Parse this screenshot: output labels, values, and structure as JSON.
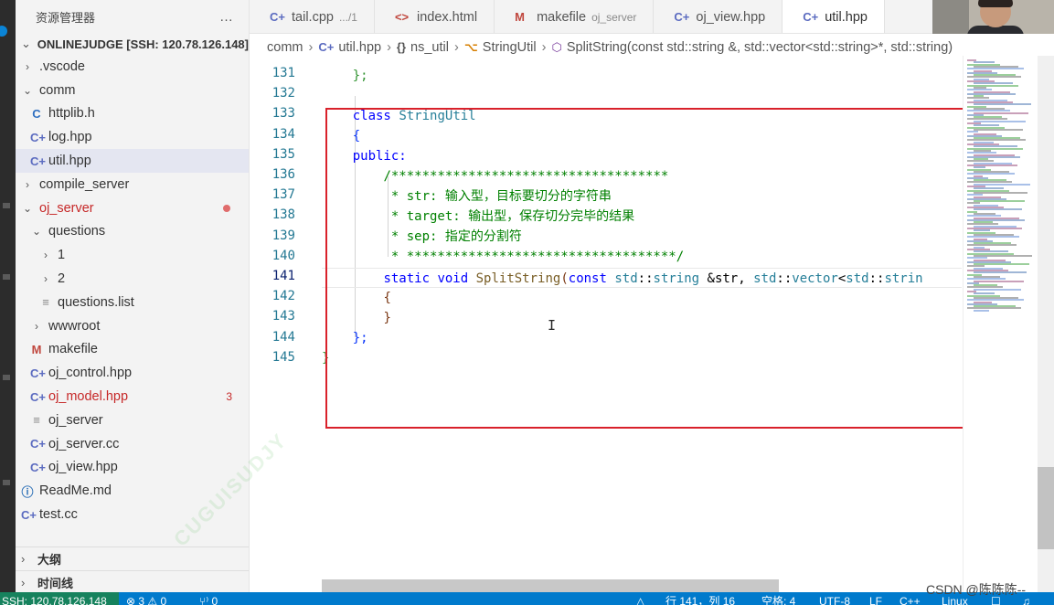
{
  "sidebar": {
    "header_title": "资源管理器",
    "more_icon": "…",
    "project_title": "ONLINEJUDGE [SSH: 120.78.126.148]",
    "items": [
      {
        "label": ".vscode",
        "chev": "›",
        "icon": "",
        "depth": 1
      },
      {
        "label": "comm",
        "chev": "⌄",
        "icon": "",
        "depth": 1
      },
      {
        "label": "httplib.h",
        "chev": "",
        "icon": "C",
        "depth": 2
      },
      {
        "label": "log.hpp",
        "chev": "",
        "icon": "C+",
        "depth": 2
      },
      {
        "label": "util.hpp",
        "chev": "",
        "icon": "C+",
        "depth": 2,
        "selected": true
      },
      {
        "label": "compile_server",
        "chev": "›",
        "icon": "",
        "depth": 1
      },
      {
        "label": "oj_server",
        "chev": "⌄",
        "icon": "",
        "depth": 1,
        "modified": true,
        "dot": true
      },
      {
        "label": "questions",
        "chev": "⌄",
        "icon": "",
        "depth": 2
      },
      {
        "label": "1",
        "chev": "›",
        "icon": "",
        "depth": 3
      },
      {
        "label": "2",
        "chev": "›",
        "icon": "",
        "depth": 3
      },
      {
        "label": "questions.list",
        "chev": "",
        "icon": "≡",
        "depth": 3
      },
      {
        "label": "wwwroot",
        "chev": "›",
        "icon": "",
        "depth": 2
      },
      {
        "label": "makefile",
        "chev": "",
        "icon": "M",
        "depth": 2
      },
      {
        "label": "oj_control.hpp",
        "chev": "",
        "icon": "C+",
        "depth": 2
      },
      {
        "label": "oj_model.hpp",
        "chev": "",
        "icon": "C+",
        "depth": 2,
        "modified": true,
        "count": "3"
      },
      {
        "label": "oj_server",
        "chev": "",
        "icon": "≡",
        "depth": 2
      },
      {
        "label": "oj_server.cc",
        "chev": "",
        "icon": "C+",
        "depth": 2
      },
      {
        "label": "oj_view.hpp",
        "chev": "",
        "icon": "C+",
        "depth": 2
      },
      {
        "label": "ReadMe.md",
        "chev": "",
        "icon": "ⓘ",
        "depth": 1
      },
      {
        "label": "test.cc",
        "chev": "",
        "icon": "C+",
        "depth": 1
      }
    ],
    "outline": "大纲",
    "timeline": "时间线"
  },
  "tabs": [
    {
      "label": "tail.cpp",
      "hint": ".../1",
      "icon": "C+"
    },
    {
      "label": "index.html",
      "hint": "",
      "icon": "<>"
    },
    {
      "label": "makefile",
      "hint": "oj_server",
      "icon": "M"
    },
    {
      "label": "oj_view.hpp",
      "hint": "",
      "icon": "C+"
    },
    {
      "label": "util.hpp",
      "hint": "",
      "icon": "C+",
      "active": true
    }
  ],
  "breadcrumb": [
    {
      "icon": "",
      "label": "comm"
    },
    {
      "icon": "C+",
      "label": "util.hpp"
    },
    {
      "icon": "{}",
      "label": "ns_util"
    },
    {
      "icon": "⌥",
      "label": "StringUtil"
    },
    {
      "icon": "⬡",
      "label": "SplitString(const std::string &, std::vector<std::string>*, std::string)"
    }
  ],
  "editor": {
    "line_numbers": [
      "131",
      "132",
      "133",
      "134",
      "135",
      "136",
      "137",
      "138",
      "139",
      "140",
      "141",
      "142",
      "143",
      "144",
      "145"
    ],
    "current_line": "141",
    "code": {
      "l131": "};",
      "l133_kw": "class",
      "l133_name": "StringUtil",
      "l134": "{",
      "l135": "public:",
      "l136": "/************************************",
      "l137_a": "* str: ",
      "l137_b": "输入型，目标要切分的字符串",
      "l138_a": "* target: ",
      "l138_b": "输出型，保存切分完毕的结果",
      "l139_a": "* sep: ",
      "l139_b": "指定的分割符",
      "l140": "* ***********************************/",
      "l141_static": "static",
      "l141_void": "void",
      "l141_fn": "SplitString",
      "l141_paren": "(",
      "l141_const": "const",
      "l141_std1": "std",
      "l141_sep1": "::",
      "l141_string": "string",
      "l141_ref": " &str, ",
      "l141_std2": "std",
      "l141_sep2": "::",
      "l141_vector": "vector",
      "l141_lt": "<",
      "l141_std3": "std",
      "l141_sep3": "::",
      "l141_tail": "strin",
      "l142": "{",
      "l143": "}",
      "l144": "};",
      "l145": "}"
    }
  },
  "statusbar": {
    "remote": "SSH: 120.78.126.148",
    "problems": "⊗ 3 ⚠ 0",
    "ports": "⑂⁾ 0",
    "position": "行 141，列 16",
    "spaces": "空格: 4",
    "encoding": "UTF-8",
    "eol": "LF",
    "language": "C++",
    "os": "Linux"
  },
  "watermark": "CUGUISUDJY",
  "csdn_caption": "CSDN @陈陈陈--",
  "colors": {
    "accent": "#007acc",
    "remote": "#16825d",
    "highlight_box": "#d9212b"
  }
}
